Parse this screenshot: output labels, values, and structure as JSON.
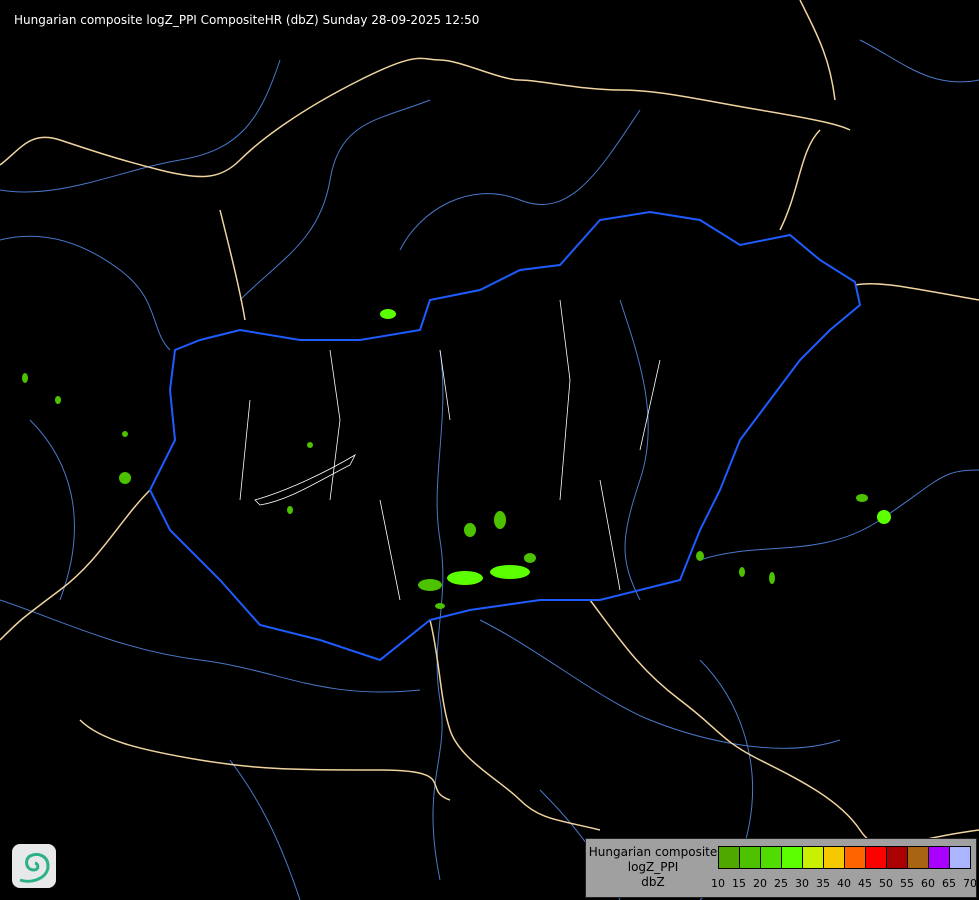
{
  "title": "Hungarian composite logZ_PPI CompositeHR (dbZ) Sunday 28-09-2025 12:50",
  "legend": {
    "name_lines": [
      "Hungarian composite",
      "logZ_PPI",
      "dbZ"
    ],
    "colors": [
      "#4ea800",
      "#4cc200",
      "#50dc00",
      "#5cff00",
      "#c8f000",
      "#f5c800",
      "#ff6400",
      "#ff0000",
      "#aa0000",
      "#a86410",
      "#aa00ff",
      "#aab4ff"
    ],
    "ticks": [
      "10",
      "15",
      "20",
      "25",
      "30",
      "35",
      "40",
      "45",
      "50",
      "55",
      "60",
      "65",
      "70"
    ]
  },
  "colors": {
    "country_border": "#f0d4a0",
    "hungary_border": "#1e5cff",
    "rivers": "#4a78c8",
    "counties": "#ffffff",
    "echo_weak": "#4cc200",
    "echo_medium": "#5cff00"
  },
  "logo": {
    "icon": "swirl-logo-icon"
  }
}
